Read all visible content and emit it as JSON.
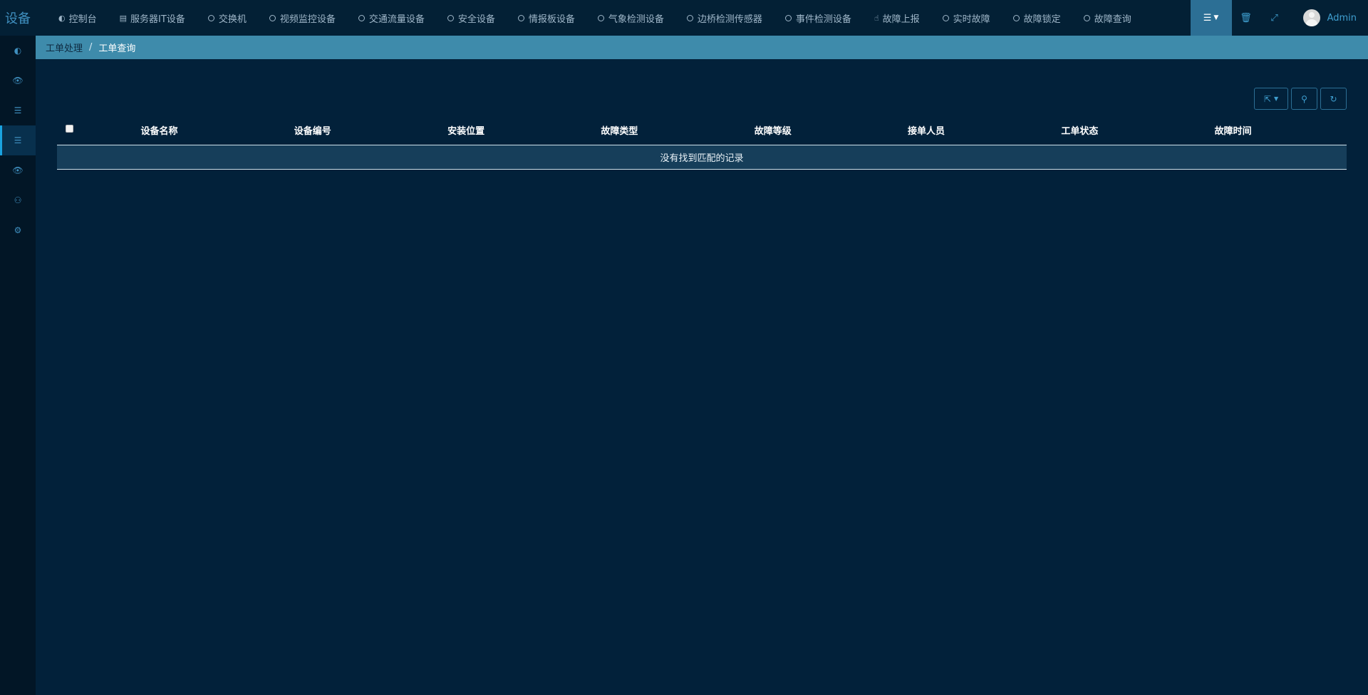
{
  "app": {
    "logo_text": "设备"
  },
  "nav": {
    "items": [
      {
        "label": "控制台",
        "icon": "dashboard-icon"
      },
      {
        "label": "服务器IT设备",
        "icon": "server-icon"
      },
      {
        "label": "交换机",
        "icon": "circle-icon"
      },
      {
        "label": "视频监控设备",
        "icon": "circle-icon"
      },
      {
        "label": "交通流量设备",
        "icon": "circle-icon"
      },
      {
        "label": "安全设备",
        "icon": "circle-icon"
      },
      {
        "label": "情报板设备",
        "icon": "circle-icon"
      },
      {
        "label": "气象检测设备",
        "icon": "circle-icon"
      },
      {
        "label": "边桥检测传感器",
        "icon": "circle-icon"
      },
      {
        "label": "事件检测设备",
        "icon": "circle-icon"
      },
      {
        "label": "故障上报",
        "icon": "hand-pointer-icon"
      },
      {
        "label": "实时故障",
        "icon": "circle-icon"
      },
      {
        "label": "故障锁定",
        "icon": "circle-icon"
      },
      {
        "label": "故障查询",
        "icon": "circle-icon"
      }
    ]
  },
  "user": {
    "name": "Admin"
  },
  "breadcrumb": {
    "parent": "工单处理",
    "separator": "/",
    "current": "工单查询"
  },
  "table": {
    "columns": [
      "设备名称",
      "设备编号",
      "安装位置",
      "故障类型",
      "故障等级",
      "接单人员",
      "工单状态",
      "故障时间"
    ],
    "empty_message": "没有找到匹配的记录"
  },
  "colors": {
    "background": "#02213a",
    "topbar": "#032035",
    "sidebar": "#021626",
    "breadcrumb_bar": "#3e8bab",
    "accent": "#3f9fd0",
    "empty_row": "#163e5a"
  }
}
